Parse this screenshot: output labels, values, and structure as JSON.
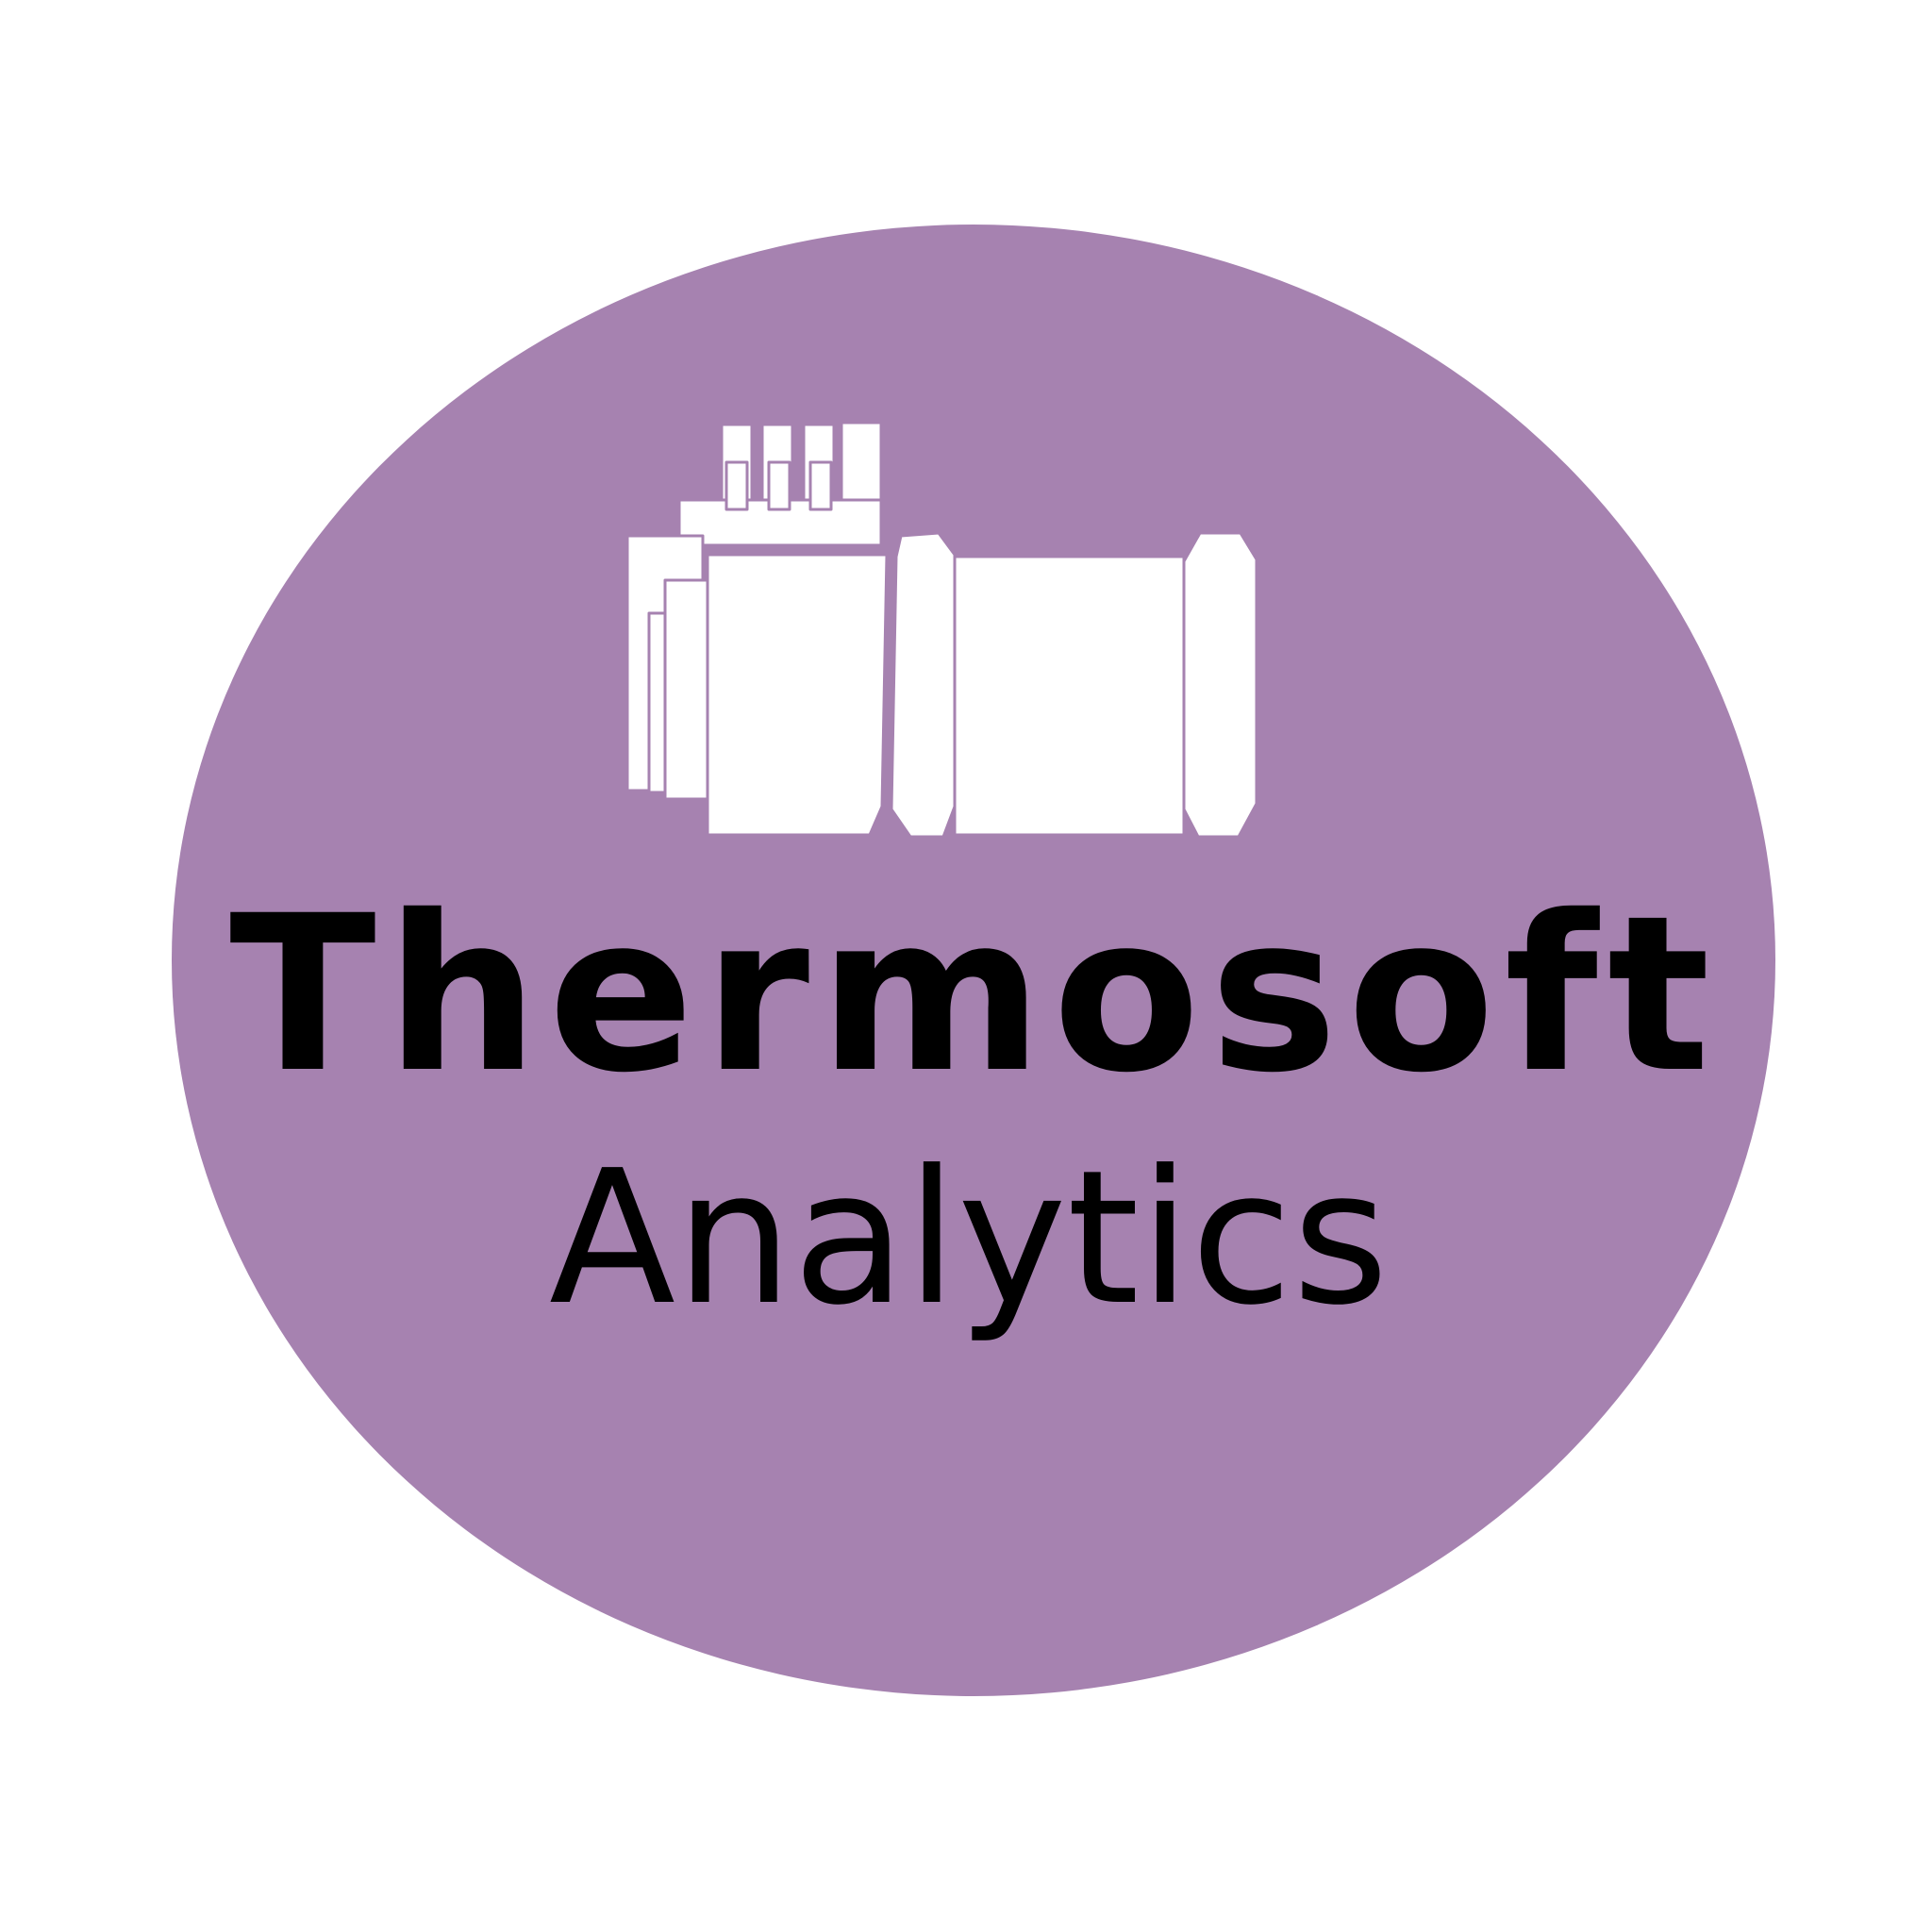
{
  "logo": {
    "name": "Thermosoft",
    "subtitle": "Analytics",
    "icon": "thermal-camera-icon"
  },
  "colors": {
    "background": "#ffffff",
    "badge": "#a682b0",
    "text": "#000000",
    "icon_fill": "#ffffff",
    "icon_outline": "#a682b0"
  }
}
